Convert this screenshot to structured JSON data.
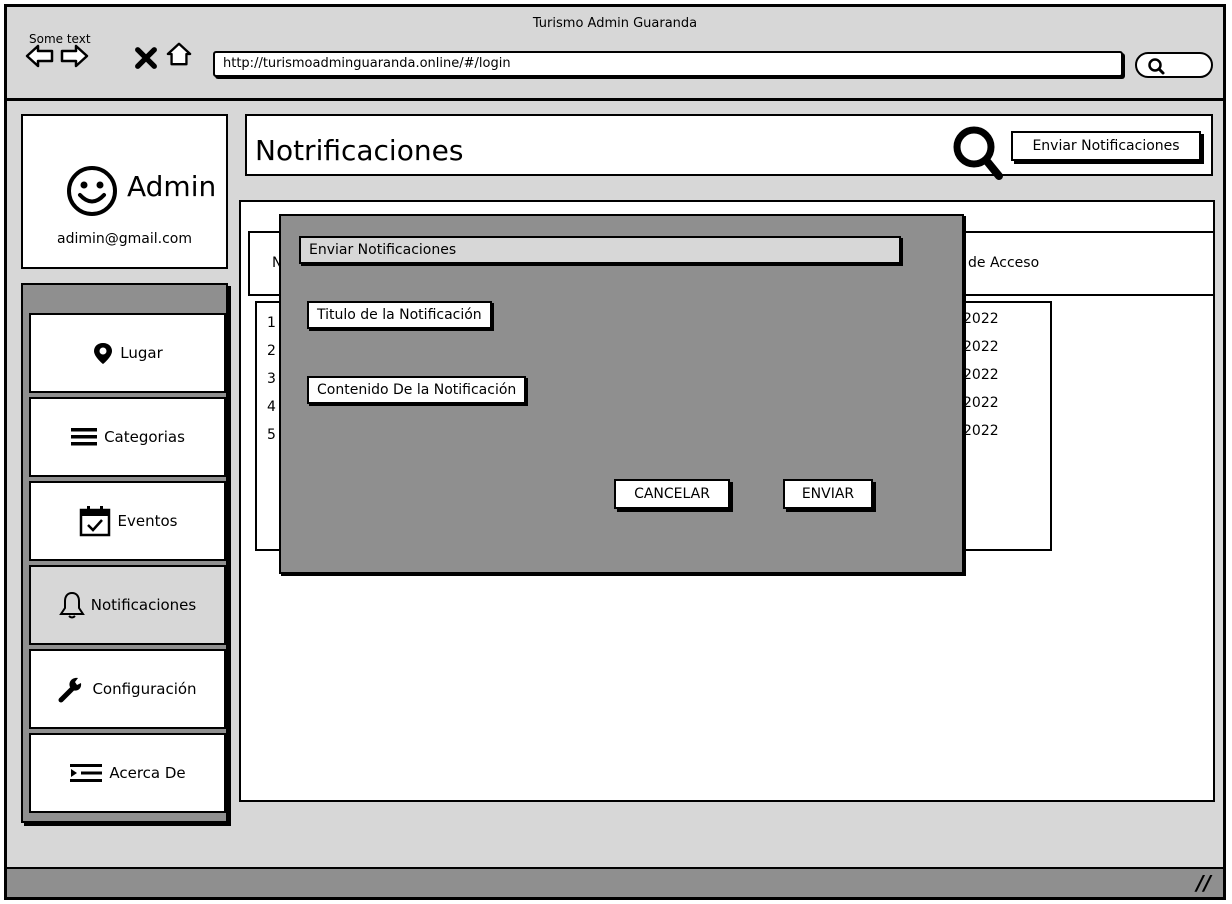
{
  "browser": {
    "title": "Turismo Admin Guaranda",
    "overlay_text": "Some text",
    "url": "http://turismoadminguaranda.online/#/login"
  },
  "user": {
    "name": "Admin",
    "email": "adimin@gmail.com"
  },
  "sidebar": {
    "items": [
      {
        "label": "Lugar",
        "icon": "map-pin-icon"
      },
      {
        "label": "Categorias",
        "icon": "menu-lines-icon"
      },
      {
        "label": "Eventos",
        "icon": "calendar-check-icon"
      },
      {
        "label": "Notificaciones",
        "icon": "bell-icon",
        "active": true
      },
      {
        "label": "Configuración",
        "icon": "wrench-icon"
      },
      {
        "label": "Acerca De",
        "icon": "indent-list-icon"
      }
    ]
  },
  "main": {
    "title": "Notrificaciones",
    "send_button": "Enviar Notificaciones",
    "table": {
      "header_left": "N",
      "header_right": "de Acceso",
      "row_numbers": [
        "1",
        "2",
        "3",
        "4",
        "5"
      ],
      "row_years": [
        "2022",
        "2022",
        "2022",
        "2022",
        "2022"
      ]
    }
  },
  "modal": {
    "title": "Enviar Notificaciones",
    "title_field": "Titulo de la Notificación",
    "content_field": "Contenido De la Notificación",
    "cancel": "CANCELAR",
    "send": "ENVIAR"
  },
  "statusbar": {
    "grip": "//"
  }
}
